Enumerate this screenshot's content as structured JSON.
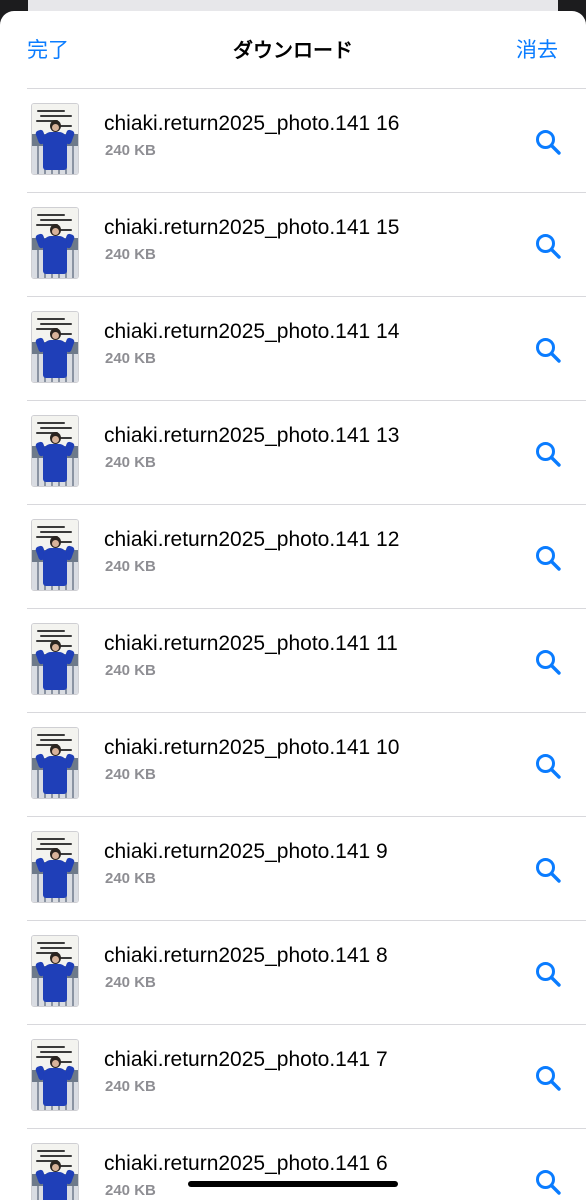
{
  "navbar": {
    "done_label": "完了",
    "title": "ダウンロード",
    "clear_label": "消去"
  },
  "accent_color": "#0a7cff",
  "downloads": [
    {
      "name": "chiaki.return2025_photo.141 16",
      "size": "240 KB"
    },
    {
      "name": "chiaki.return2025_photo.141 15",
      "size": "240 KB"
    },
    {
      "name": "chiaki.return2025_photo.141 14",
      "size": "240 KB"
    },
    {
      "name": "chiaki.return2025_photo.141 13",
      "size": "240 KB"
    },
    {
      "name": "chiaki.return2025_photo.141 12",
      "size": "240 KB"
    },
    {
      "name": "chiaki.return2025_photo.141 11",
      "size": "240 KB"
    },
    {
      "name": "chiaki.return2025_photo.141 10",
      "size": "240 KB"
    },
    {
      "name": "chiaki.return2025_photo.141 9",
      "size": "240 KB"
    },
    {
      "name": "chiaki.return2025_photo.141 8",
      "size": "240 KB"
    },
    {
      "name": "chiaki.return2025_photo.141 7",
      "size": "240 KB"
    },
    {
      "name": "chiaki.return2025_photo.141 6",
      "size": "240 KB"
    }
  ],
  "row_icons": {
    "thumbnail": "photo-thumbnail",
    "action": "magnifying-glass-icon"
  }
}
